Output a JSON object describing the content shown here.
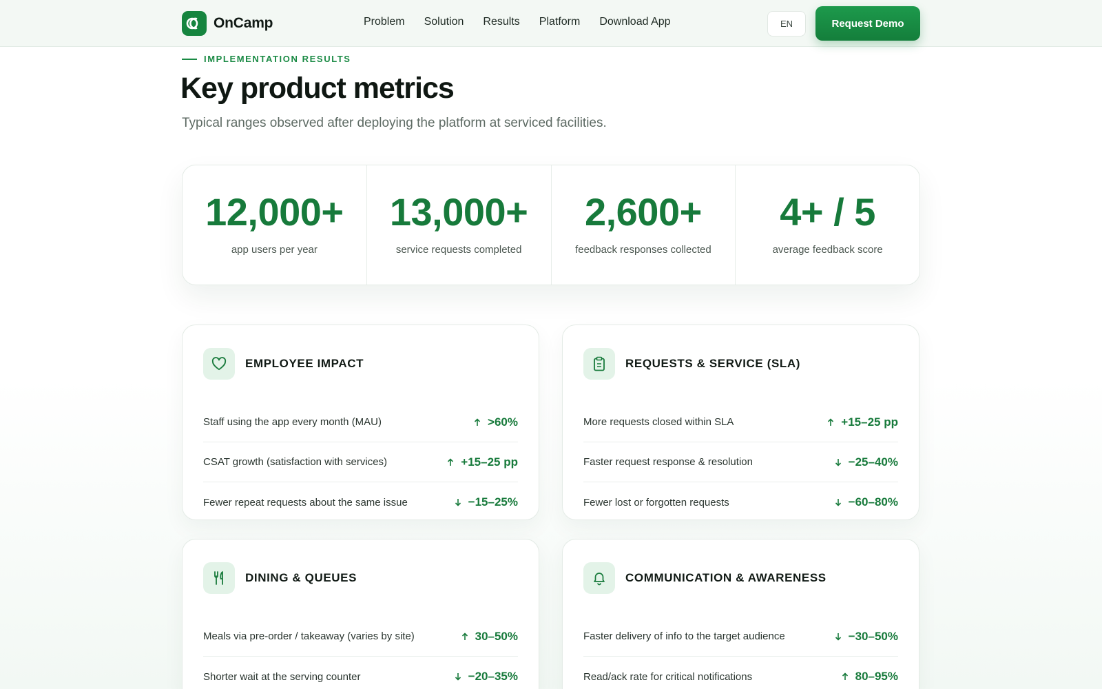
{
  "nav": {
    "brand": "OnCamp",
    "links": [
      "Problem",
      "Solution",
      "Results",
      "Platform",
      "Download App"
    ],
    "language": "EN",
    "cta": "Request Demo"
  },
  "header": {
    "eyebrow": "IMPLEMENTATION RESULTS",
    "title": "Key product metrics",
    "subtitle": "Typical ranges observed after deploying the platform at serviced facilities."
  },
  "stats": [
    {
      "value": "12,000+",
      "label": "app users per year"
    },
    {
      "value": "13,000+",
      "label": "service requests completed"
    },
    {
      "value": "2,600+",
      "label": "feedback responses collected"
    },
    {
      "value": "4+ / 5",
      "label": "average feedback score"
    }
  ],
  "cards": [
    {
      "title": "EMPLOYEE IMPACT",
      "icon": "heart-icon",
      "rows": [
        {
          "label": "Staff using the app every month (MAU)",
          "value": ">60%",
          "trend": "up"
        },
        {
          "label": "CSAT growth (satisfaction with services)",
          "value": "+15–25 pp",
          "trend": "up"
        },
        {
          "label": "Fewer repeat requests about the same issue",
          "value": "−15–25%",
          "trend": "down"
        }
      ]
    },
    {
      "title": "REQUESTS & SERVICE (SLA)",
      "icon": "clipboard-icon",
      "rows": [
        {
          "label": "More requests closed within SLA",
          "value": "+15–25 pp",
          "trend": "up"
        },
        {
          "label": "Faster request response & resolution",
          "value": "−25–40%",
          "trend": "down"
        },
        {
          "label": "Fewer lost or forgotten requests",
          "value": "−60–80%",
          "trend": "down"
        }
      ]
    },
    {
      "title": "DINING & QUEUES",
      "icon": "utensils-icon",
      "rows": [
        {
          "label": "Meals via pre-order / takeaway (varies by site)",
          "value": "30–50%",
          "trend": "up"
        },
        {
          "label": "Shorter wait at the serving counter",
          "value": "−20–35%",
          "trend": "down"
        }
      ]
    },
    {
      "title": "COMMUNICATION & AWARENESS",
      "icon": "bell-icon",
      "rows": [
        {
          "label": "Faster delivery of info to the target audience",
          "value": "−30–50%",
          "trend": "down"
        },
        {
          "label": "Read/ack rate for critical notifications",
          "value": "80–95%",
          "trend": "up"
        }
      ]
    }
  ],
  "colors": {
    "accent": "#177a3b",
    "brand": "#16853f",
    "icon_bg": "#e3f3e8"
  }
}
